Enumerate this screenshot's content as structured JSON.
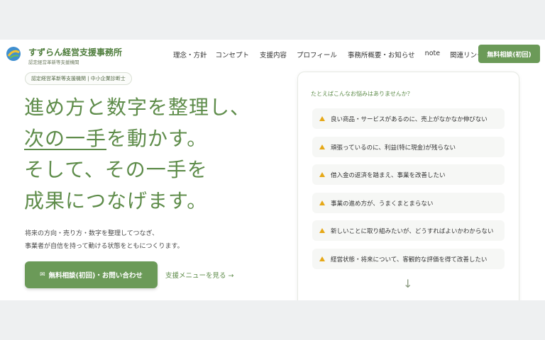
{
  "brand": {
    "name": "すずらん経営支援事務所",
    "subtitle": "認定経営革新等支援機関"
  },
  "nav": {
    "items": [
      "理念・方針",
      "コンセプト",
      "支援内容",
      "プロフィール",
      "事務所概要・お知らせ",
      "note",
      "関連リンク"
    ],
    "cta_label": "無料相談(初回)"
  },
  "hero": {
    "badge": "認定経営革新等支援機関 | 中小企業診断士",
    "headline_line1": "進め方と数字を整理し、",
    "headline_line2_underlined": "次の一手",
    "headline_line2_rest": "を動かす。",
    "headline_line3": "そして、その一手を",
    "headline_line4": "成果につなげます。",
    "lead_line1": "将来の方向・売り方・数字を整理してつなぎ、",
    "lead_line2": "事業者が自信を持って動ける状態をともにつくります。",
    "cta_label": "無料相談(初回)・お問い合わせ",
    "menu_link": "支援メニューを見る →"
  },
  "worries": {
    "title": "たとえばこんなお悩みはありませんか？",
    "items": [
      "良い商品・サービスがあるのに、売上がなかなか伸びない",
      "頑張っているのに、利益(特に現金)が残らない",
      "借入金の返済を踏まえ、事業を改善したい",
      "事業の進め方が、うまくまとまらない",
      "新しいことに取り組みたいが、どうすればよいかわからない",
      "経営状態・将来について、客観的な評価を得て改善したい"
    ],
    "arrow": "↓"
  },
  "colors": {
    "accent": "#6b9a58",
    "headline": "#5e8c4a",
    "warning": "#e6a817"
  }
}
